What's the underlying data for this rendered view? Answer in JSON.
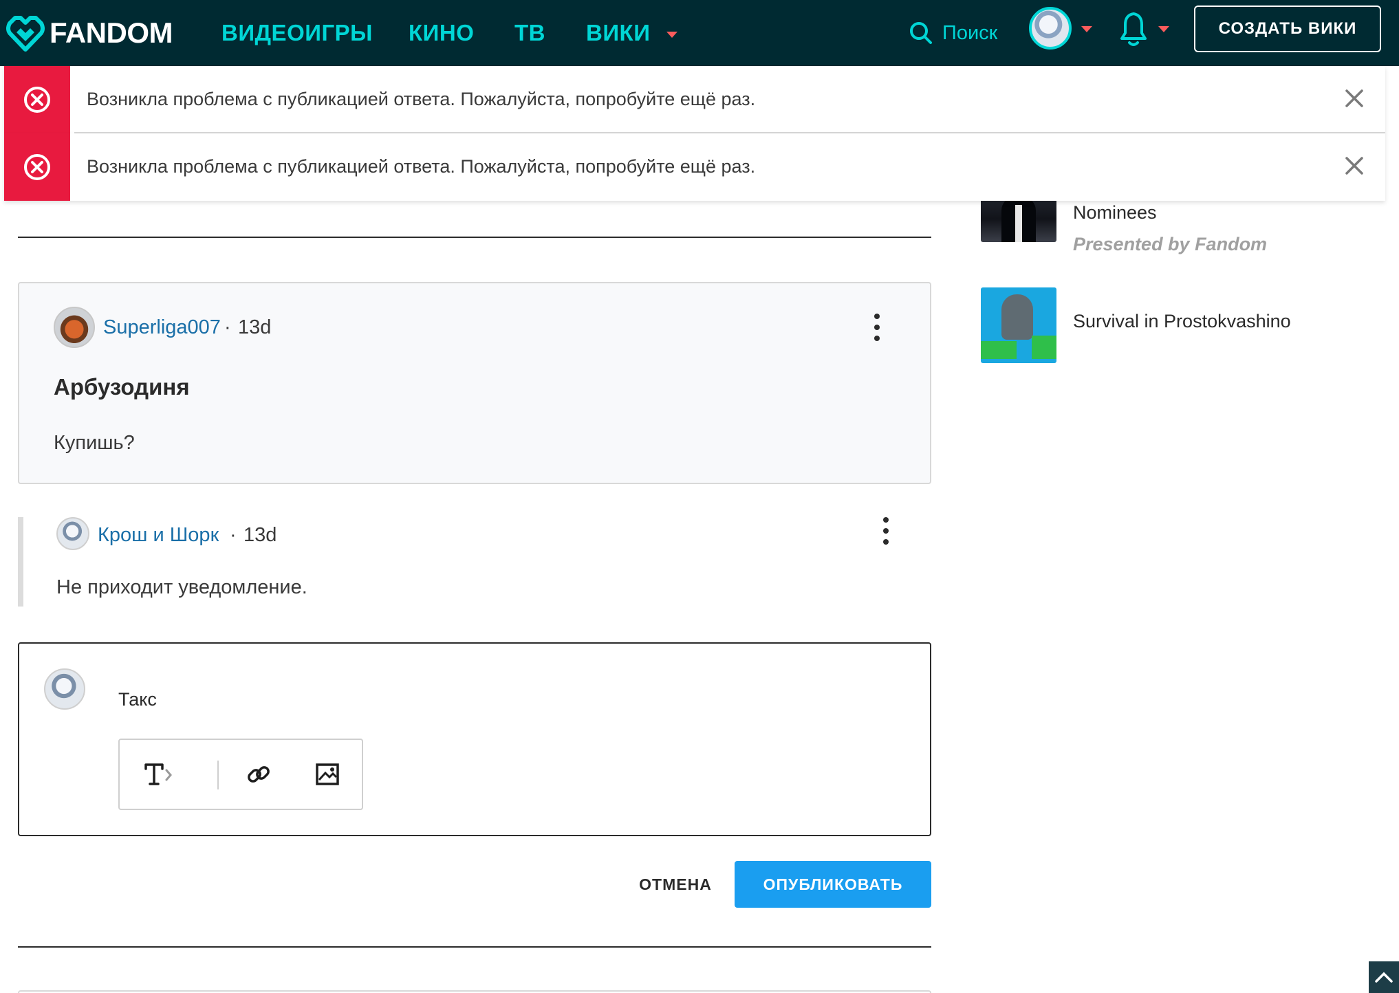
{
  "nav": {
    "logo_text": "FANDOM",
    "items": [
      {
        "label": "ВИДЕОИГРЫ"
      },
      {
        "label": "КИНО"
      },
      {
        "label": "ТВ"
      },
      {
        "label": "ВИКИ"
      }
    ],
    "search_label": "Поиск",
    "create_button": "СОЗДАТЬ ВИКИ",
    "accent_color": "#00d6d6",
    "background_color": "#002a32"
  },
  "errors": [
    {
      "message": "Возникла проблема с публикацией ответа. Пожалуйста, попробуйте ещё раз."
    },
    {
      "message": "Возникла проблема с публикацией ответа. Пожалуйста, попробуйте ещё раз."
    }
  ],
  "error_color": "#e81a3f",
  "sidebar": {
    "items": [
      {
        "title": "Nominees",
        "presented": "Presented by Fandom"
      },
      {
        "title": "Survival in Prostokvashino"
      }
    ]
  },
  "post": {
    "author": "Superliga007",
    "separator": "·",
    "age": "13d",
    "title": "Арбузодиня",
    "body": "Купишь?"
  },
  "reply": {
    "author": "Крош и Шорк",
    "separator": "·",
    "age": "13d",
    "body": "Не приходит уведомление."
  },
  "composer": {
    "text": "Такс",
    "cancel_label": "ОТМЕНА",
    "publish_label": "ОПУБЛИКОВАТЬ",
    "publish_color": "#1a9ef0"
  }
}
